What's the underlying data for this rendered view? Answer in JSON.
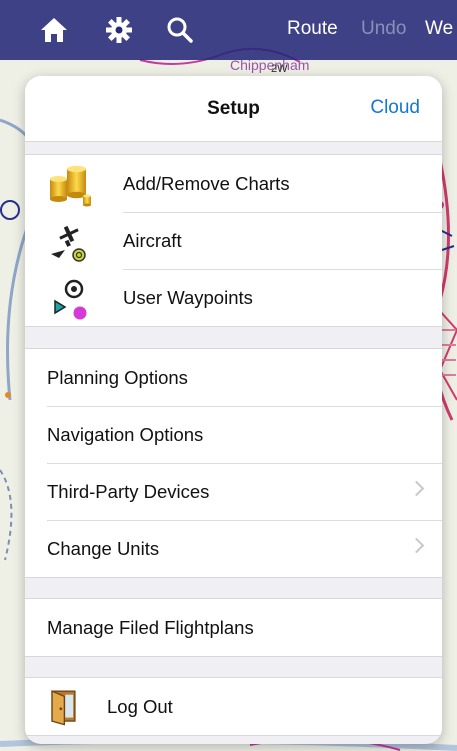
{
  "toolbar": {
    "icons": [
      "home-icon",
      "gear-icon",
      "search-icon"
    ],
    "route_label": "Route",
    "undo_label": "Undo",
    "we_label": "We"
  },
  "map": {
    "labels": [
      "Chippenham",
      "2W"
    ]
  },
  "setup": {
    "title": "Setup",
    "cloud_label": "Cloud",
    "top_items": [
      {
        "label": "Add/Remove Charts",
        "icon": "charts-database-icon"
      },
      {
        "label": "Aircraft",
        "icon": "aircraft-icon"
      },
      {
        "label": "User Waypoints",
        "icon": "user-waypoints-icon"
      }
    ],
    "options_items": [
      {
        "label": "Planning Options",
        "chevron": false
      },
      {
        "label": "Navigation Options",
        "chevron": false
      },
      {
        "label": "Third-Party Devices",
        "chevron": true
      },
      {
        "label": "Change Units",
        "chevron": true
      }
    ],
    "flightplans_label": "Manage Filed Flightplans",
    "logout": {
      "label": "Log Out",
      "icon": "door-icon"
    }
  },
  "colors": {
    "toolbar": "#262878",
    "accent": "#1476d6",
    "panel_bg": "#efeff4",
    "map_magenta": "#c23aa0"
  }
}
